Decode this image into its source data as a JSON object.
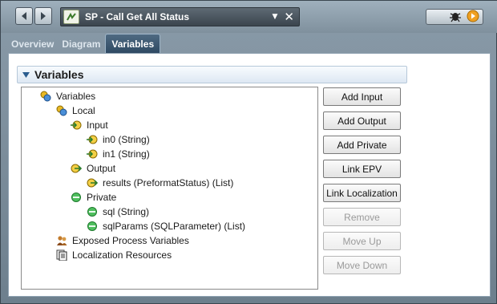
{
  "window": {
    "title": "SP - Call Get All Status"
  },
  "tabs": [
    {
      "label": "Overview",
      "active": false
    },
    {
      "label": "Diagram",
      "active": false
    },
    {
      "label": "Variables",
      "active": true
    }
  ],
  "section": {
    "title": "Variables"
  },
  "tree": {
    "root": "Variables",
    "local": "Local",
    "input": "Input",
    "in0": "in0 (String)",
    "in1": "in1 (String)",
    "output": "Output",
    "results": "results (PreformatStatus) (List)",
    "private": "Private",
    "sql": "sql (String)",
    "sqlParams": "sqlParams (SQLParameter) (List)",
    "exposed": "Exposed Process Variables",
    "localization": "Localization Resources"
  },
  "buttons": [
    {
      "label": "Add Input",
      "enabled": true
    },
    {
      "label": "Add Output",
      "enabled": true
    },
    {
      "label": "Add Private",
      "enabled": true
    },
    {
      "label": "Link EPV",
      "enabled": true
    },
    {
      "label": "Link Localization",
      "enabled": true
    },
    {
      "label": "Remove",
      "enabled": false
    },
    {
      "label": "Move Up",
      "enabled": false
    },
    {
      "label": "Move Down",
      "enabled": false
    }
  ],
  "colors": {
    "active_tab": "#3c5a74",
    "private_green": "#3aa64c",
    "io_yellow": "#e8b825"
  }
}
